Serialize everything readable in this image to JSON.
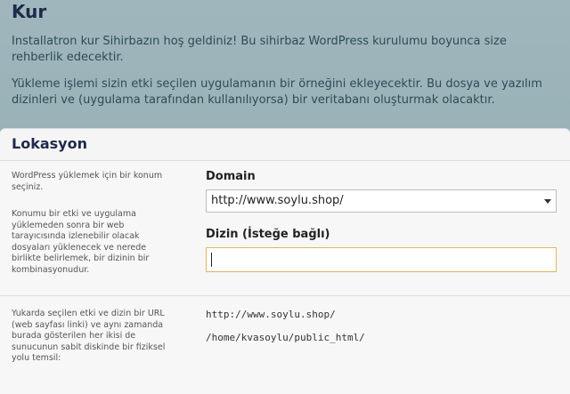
{
  "header": {
    "title": "Kur",
    "intro1": "Installatron kur Sihirbazın hoş geldiniz! Bu sihirbaz WordPress kurulumu boyunca size rehberlik edecektir.",
    "intro2": "Yükleme işlemi sizin etki seçilen uygulamanın bir örneğini ekleyecektir. Bu dosya ve yazılım dizinleri ve (uygulama tarafından kullanılıyorsa) bir veritabanı oluşturmak olacaktır."
  },
  "panel": {
    "title": "Lokasyon",
    "help_choose_location": "WordPress yüklemek için bir konum seçiniz.",
    "help_location_detail": "Konumu bir etki ve uygulama yüklemeden sonra bir web tarayıcısında izlenebilir olacak dosyaları yüklenecek ve nerede birlikte belirlemek, bir dizinin bir kombinasyonudur.",
    "domain_label": "Domain",
    "domain_value": "http://www.soylu.shop/",
    "directory_label": "Dizin (İsteğe bağlı)",
    "directory_value": "",
    "help_paths": "Yukarda seçilen etki ve dizin bir URL (web sayfası linki) ve aynı zamanda burada gösterilen her ikisi de sunucunun sabit diskinde bir fiziksel yolu temsil:",
    "url_path": "http://www.soylu.shop/",
    "filesystem_path": "/home/kvasoylu/public_html/"
  }
}
